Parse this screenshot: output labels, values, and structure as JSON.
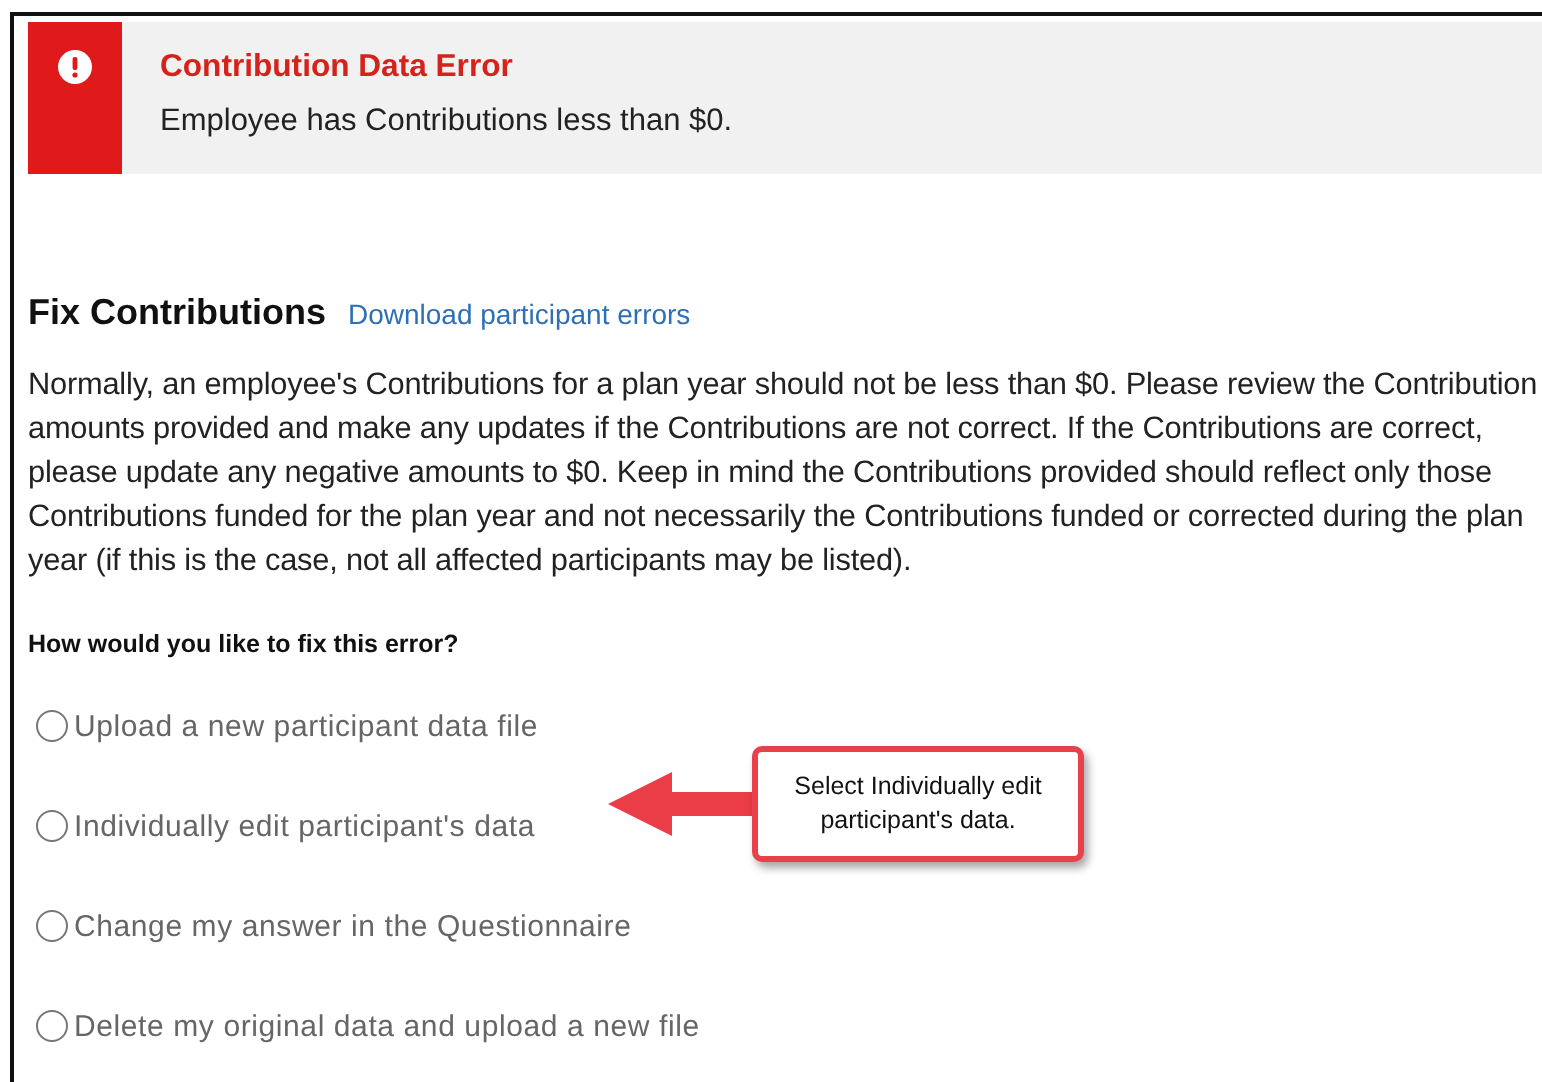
{
  "alert": {
    "kind": "error",
    "title": "Contribution Data Error",
    "message": "Employee has Contributions less than $0."
  },
  "section": {
    "heading": "Fix Contributions",
    "link": "Download participant errors",
    "description": "Normally, an employee's Contributions for a plan year should not be less than $0. Please review the Contribution amounts provided and make any updates if the Contributions are not correct. If the Contributions are correct, please update any negative amounts to $0. Keep in mind the Contributions provided should reflect only those Contributions funded for the plan year and not necessarily the Contributions funded or corrected during the plan year (if this is the case, not all affected participants may be listed).",
    "question": "How would you like to fix this error?"
  },
  "options": [
    {
      "label": "Upload a new participant data file",
      "selected": false
    },
    {
      "label": "Individually edit participant's data",
      "selected": false,
      "callout": "Select Individually edit participant's data."
    },
    {
      "label": "Change my answer in the Questionnaire",
      "selected": false
    },
    {
      "label": "Delete my original data and upload a new file",
      "selected": false
    }
  ]
}
